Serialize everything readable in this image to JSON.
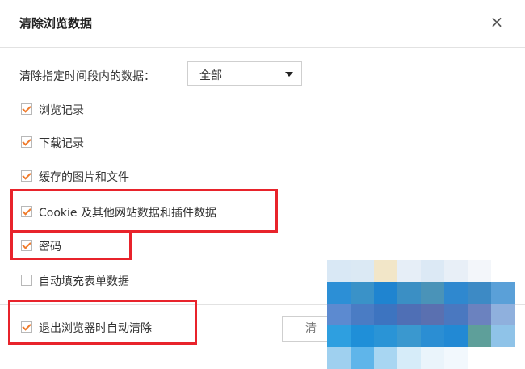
{
  "dialog": {
    "title": "清除浏览数据",
    "close_glyph": "×"
  },
  "range": {
    "label": "清除指定时间段内的数据：",
    "selected": "全部"
  },
  "options": [
    {
      "label": "浏览记录",
      "checked": true
    },
    {
      "label": "下载记录",
      "checked": true
    },
    {
      "label": "缓存的图片和文件",
      "checked": true
    },
    {
      "label": "Cookie 及其他网站数据和插件数据",
      "checked": true
    },
    {
      "label": "密码",
      "checked": true
    },
    {
      "label": "自动填充表单数据",
      "checked": false
    },
    {
      "label": "退出浏览器时自动清除",
      "checked": true
    }
  ],
  "footer": {
    "clear_button_partial": "清"
  },
  "colors": {
    "checkmark": "#f07b2c",
    "highlight": "#e8232b"
  }
}
